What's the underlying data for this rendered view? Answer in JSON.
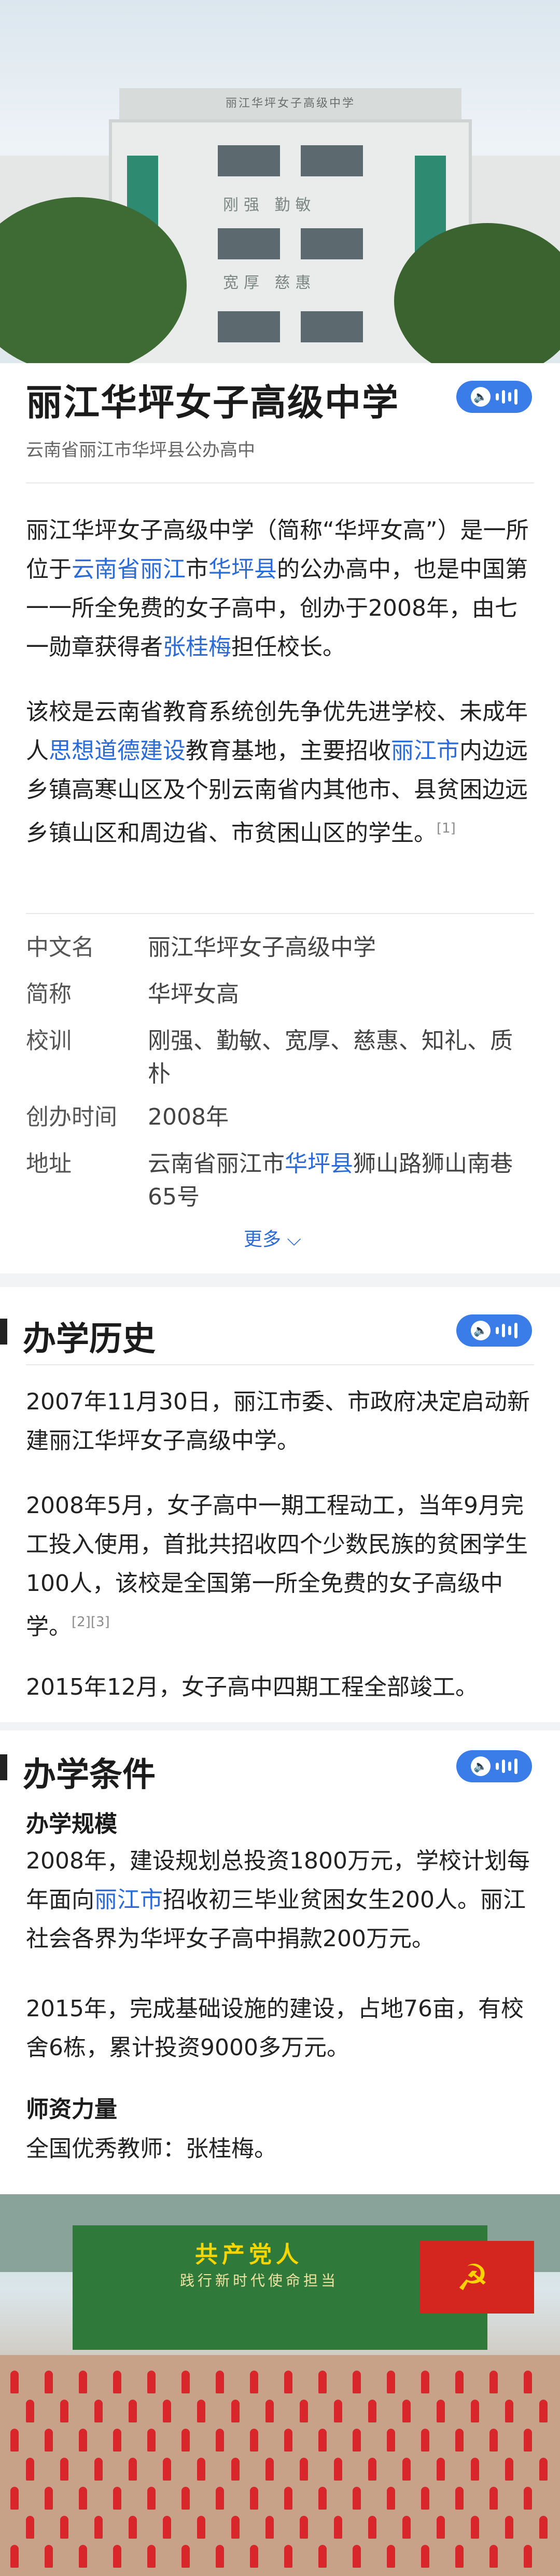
{
  "hero": {
    "sign_text": "丽江华坪女子高级中学",
    "motto_1": "刚强  勤敏",
    "motto_2": "宽厚  慈惠"
  },
  "header": {
    "title": "丽江华坪女子高级中学",
    "subtitle": "云南省丽江市华坪县公办高中"
  },
  "intro": {
    "p1_a": "丽江华坪女子高级中学（简称“华坪女高”）是一所位于",
    "p1_link1": "云南省",
    "p1_link2": "丽江",
    "p1_b": "市",
    "p1_link3": "华坪县",
    "p1_c": "的公办高中，也是中国第一一所全免费的女子高中，创办于2008年，由七一勋章获得者",
    "p1_link4": "张桂梅",
    "p1_d": "担任校长。",
    "p2_a": "该校是云南省教育系统创先争优先进学校、未成年人",
    "p2_link1": "思想道德建设",
    "p2_b": "教育基地，主要招收",
    "p2_link2": "丽江市",
    "p2_c": "内边远乡镇高寒山区及个别云南省内其他市、县贫困边远乡镇山区和周边省、市贫困山区的学生。",
    "p2_ref": "[1]"
  },
  "info": {
    "rows": [
      {
        "label": "中文名",
        "value": "丽江华坪女子高级中学"
      },
      {
        "label": "简称",
        "value": "华坪女高"
      },
      {
        "label": "校训",
        "value": "刚强、勤敏、宽厚、慈惠、知礼、质朴"
      },
      {
        "label": "创办时间",
        "value": "2008年"
      }
    ],
    "address_label": "地址",
    "address_a": "云南省丽江市",
    "address_link": "华坪县",
    "address_b": "狮山路狮山南巷65号",
    "more": "更多 ⌵"
  },
  "history": {
    "title": "办学历史",
    "p1": "2007年11月30日，丽江市委、市政府决定启动新建丽江华坪女子高级中学。",
    "p2": "2008年5月，女子高中一期工程动工，当年9月完工投入使用，首批共招收四个少数民族的贫困学生100人，该校是全国第一所全免费的女子高级中学。",
    "p2_ref": "[2][3]",
    "p3": "2015年12月，女子高中四期工程全部竣工。"
  },
  "conditions": {
    "title": "办学条件",
    "scale_head": "办学规模",
    "s1_a": "2008年，建设规划总投资1800万元，学校计划每年面向",
    "s1_link": "丽江市",
    "s1_b": "招收初三毕业贫困女生200人。丽江社会各界为华坪女子高中捐款200万元。",
    "s2": "2015年，完成基础设施的建设，占地76亩，有校舍6栋，累计投资9000多万元。",
    "teacher_head": "师资力量",
    "t1": "全国优秀教师：张桂梅。"
  },
  "photo2": {
    "banner": "共产党人",
    "banner2": "践行新时代使命担当",
    "flag_symbol": "☭"
  },
  "colors": {
    "link": "#2a6bd8",
    "audio_button": "#3a7de8"
  },
  "icons": {
    "audio": "speaker-icon"
  }
}
